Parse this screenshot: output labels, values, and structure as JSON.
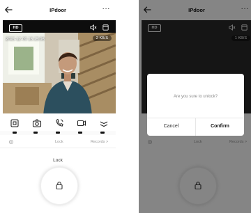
{
  "app": {
    "title": "IPdoor",
    "more_label": "···"
  },
  "video": {
    "hd_label": "HD",
    "timestamp": "2023-12-09 16:15:06",
    "bitrate": "2 KB/S"
  },
  "controls": [
    "screenshot-icon",
    "camera-icon",
    "call-icon",
    "record-icon",
    "expand-icon"
  ],
  "tabs": {
    "lock_label": "Lock",
    "records_label": "Records >"
  },
  "lock": {
    "label": "Lock"
  },
  "overlay": {
    "bitrate": "1 KB/S"
  },
  "dialog": {
    "message": "Are you sure to unlock?",
    "cancel_label": "Cancel",
    "confirm_label": "Confirm"
  }
}
